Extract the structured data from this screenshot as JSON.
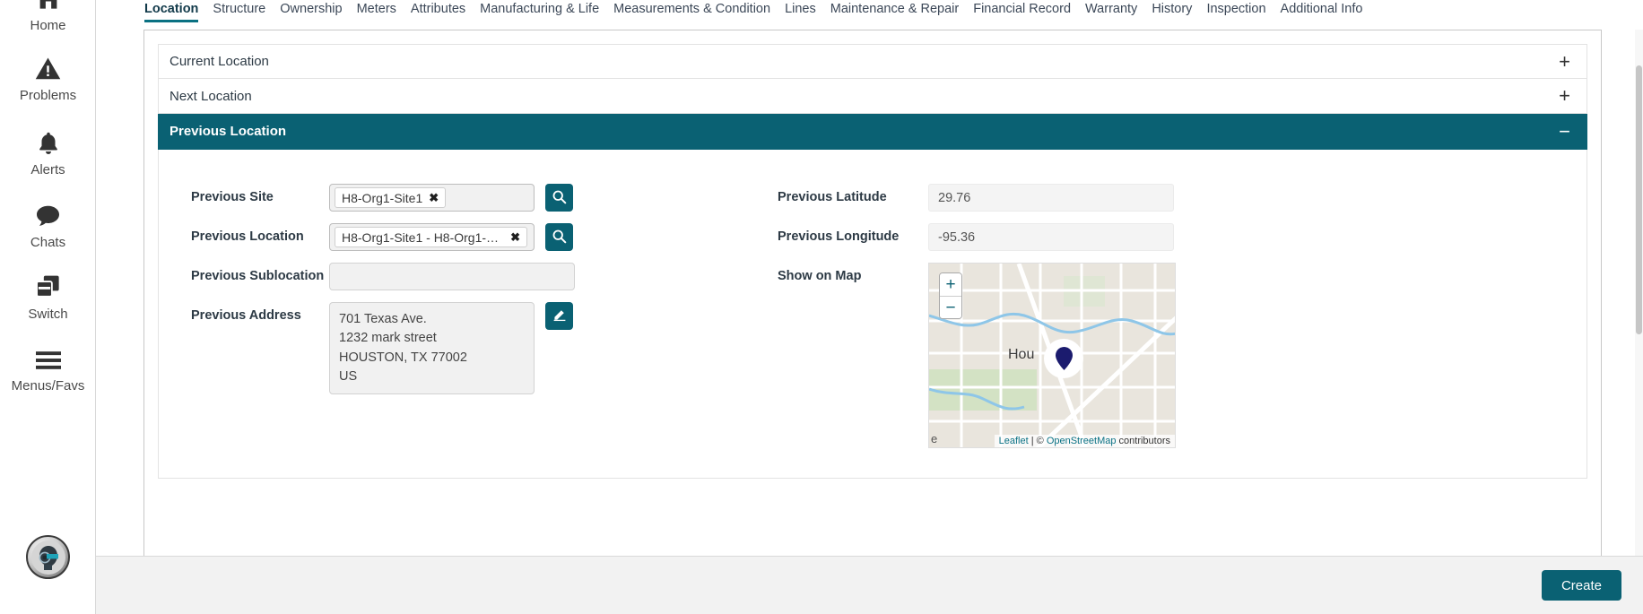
{
  "sidebar": {
    "items": [
      {
        "label": "Home",
        "icon": "home-icon"
      },
      {
        "label": "Problems",
        "icon": "warning-triangle-icon"
      },
      {
        "label": "Alerts",
        "icon": "bell-icon"
      },
      {
        "label": "Chats",
        "icon": "chat-bubble-icon"
      },
      {
        "label": "Switch",
        "icon": "switch-windows-icon",
        "badge_icon": "exchange-arrows-icon"
      },
      {
        "label": "Menus/Favs",
        "icon": "hamburger-menu-icon"
      }
    ],
    "avatar_icon": "user-avatar"
  },
  "tabs": [
    {
      "label": "Location",
      "active": true
    },
    {
      "label": "Structure",
      "active": false
    },
    {
      "label": "Ownership",
      "active": false
    },
    {
      "label": "Meters",
      "active": false
    },
    {
      "label": "Attributes",
      "active": false
    },
    {
      "label": "Manufacturing & Life",
      "active": false
    },
    {
      "label": "Measurements & Condition",
      "active": false
    },
    {
      "label": "Lines",
      "active": false
    },
    {
      "label": "Maintenance & Repair",
      "active": false
    },
    {
      "label": "Financial Record",
      "active": false
    },
    {
      "label": "Warranty",
      "active": false
    },
    {
      "label": "History",
      "active": false
    },
    {
      "label": "Inspection",
      "active": false
    },
    {
      "label": "Additional Info",
      "active": false
    }
  ],
  "accordions": [
    {
      "title": "Current Location",
      "sign": "+",
      "expanded": false
    },
    {
      "title": "Next Location",
      "sign": "+",
      "expanded": false
    },
    {
      "title": "Previous Location",
      "sign": "−",
      "expanded": true
    }
  ],
  "form": {
    "previous_site": {
      "label": "Previous Site",
      "token": "H8-Org1-Site1",
      "token_remove": "✖",
      "search_icon": "search-icon"
    },
    "previous_location": {
      "label": "Previous Location",
      "token": "H8-Org1-Site1 - H8-Org1-S...",
      "token_remove": "✖",
      "search_icon": "search-icon"
    },
    "previous_sublocation": {
      "label": "Previous Sublocation",
      "value": "",
      "placeholder": ""
    },
    "previous_address": {
      "label": "Previous Address",
      "lines": [
        "701 Texas Ave.",
        "1232 mark street",
        "HOUSTON, TX  77002",
        "US"
      ],
      "edit_icon": "edit-pencil-icon"
    },
    "previous_latitude": {
      "label": "Previous Latitude",
      "value": "29.76"
    },
    "previous_longitude": {
      "label": "Previous Longitude",
      "value": "-95.36"
    },
    "show_on_map": {
      "label": "Show on Map"
    }
  },
  "map": {
    "zoom_in": "+",
    "zoom_out": "−",
    "city_label": "Hou",
    "edge_letter": "e",
    "marker_icon": "map-pin-marker",
    "attribution_leaflet": "Leaflet",
    "attribution_separator": " | © ",
    "attribution_osm": "OpenStreetMap",
    "attribution_suffix": " contributors"
  },
  "footer": {
    "create_label": "Create"
  },
  "colors": {
    "accent_teal": "#0a6173",
    "tab_underline": "#0a7182",
    "switch_badge_blue": "#3c7ea3",
    "marker_navy": "#1b1b6e"
  }
}
